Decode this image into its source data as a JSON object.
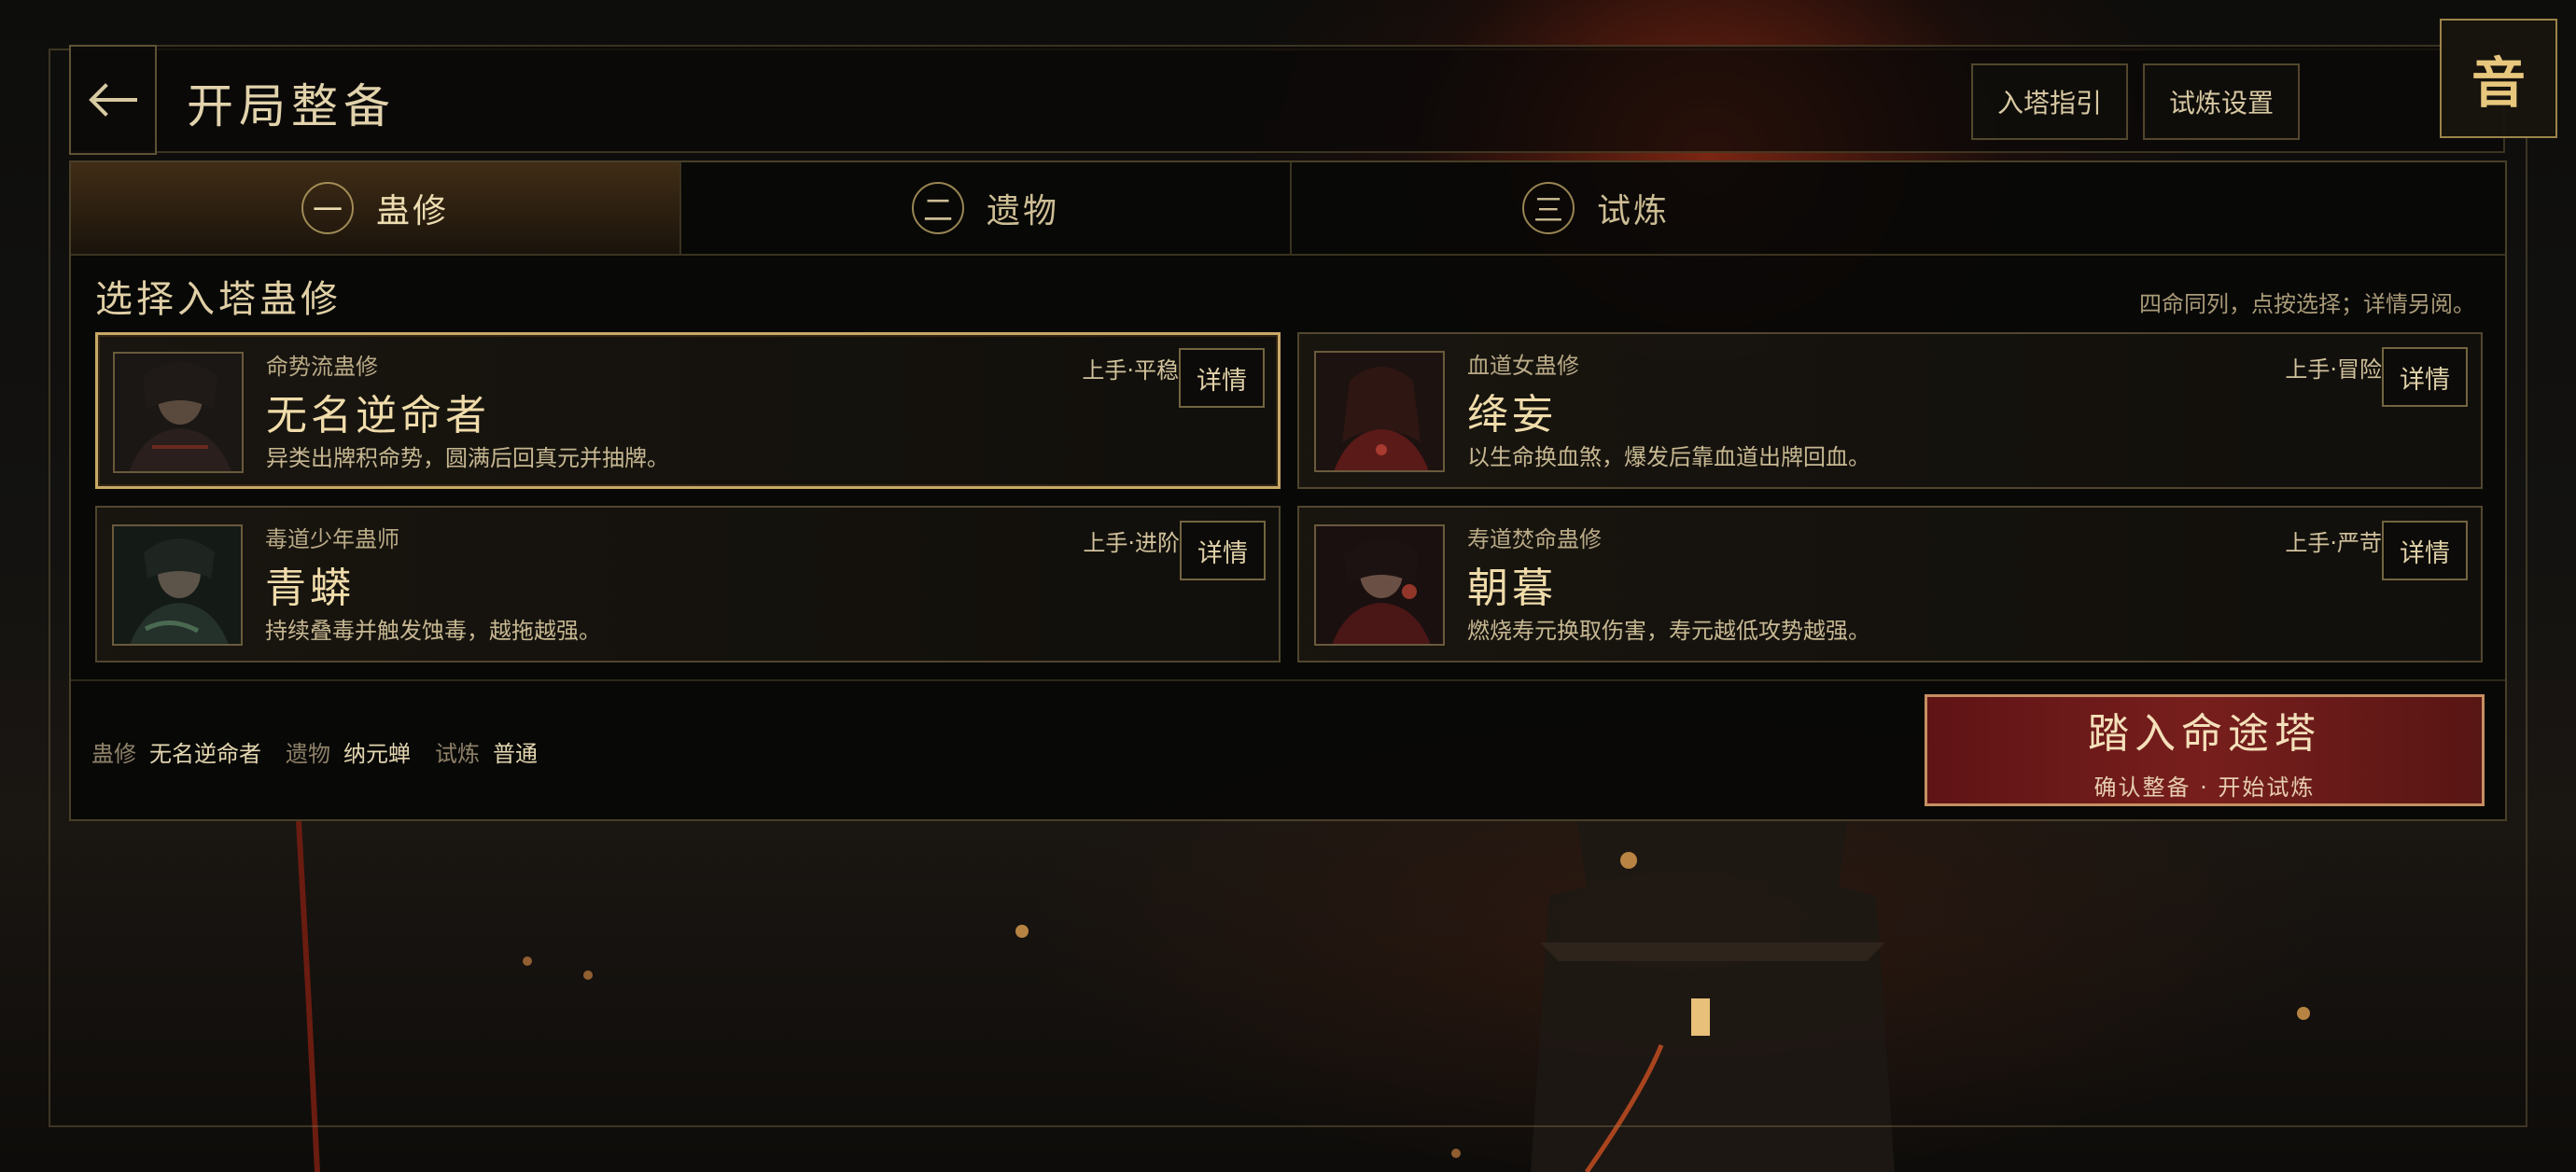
{
  "header": {
    "back_icon": "left-arrow-icon",
    "title": "开局整备",
    "buttons": [
      "入塔指引",
      "试炼设置"
    ],
    "sound_label": "音"
  },
  "tabs": [
    {
      "num": "一",
      "label": "蛊修",
      "active": true
    },
    {
      "num": "二",
      "label": "遗物",
      "active": false
    },
    {
      "num": "三",
      "label": "试炼",
      "active": false
    }
  ],
  "section": {
    "title": "选择入塔蛊修",
    "hint": "四命同列，点按选择；详情另阅。"
  },
  "cards": [
    {
      "subtitle": "命势流蛊修",
      "name": "无名逆命者",
      "desc": "异类出牌积命势，圆满后回真元并抽牌。",
      "difficulty": "上手·平稳",
      "detail": "详情",
      "selected": true
    },
    {
      "subtitle": "血道女蛊修",
      "name": "绛妄",
      "desc": "以生命换血煞，爆发后靠血道出牌回血。",
      "difficulty": "上手·冒险",
      "detail": "详情",
      "selected": false
    },
    {
      "subtitle": "毒道少年蛊师",
      "name": "青蟒",
      "desc": "持续叠毒并触发蚀毒，越拖越强。",
      "difficulty": "上手·进阶",
      "detail": "详情",
      "selected": false
    },
    {
      "subtitle": "寿道焚命蛊修",
      "name": "朝暮",
      "desc": "燃烧寿元换取伤害，寿元越低攻势越强。",
      "difficulty": "上手·严苛",
      "detail": "详情",
      "selected": false
    }
  ],
  "summary": {
    "gu_label": "蛊修",
    "gu_value": "无名逆命者",
    "relic_label": "遗物",
    "relic_value": "纳元蝉",
    "trial_label": "试炼",
    "trial_value": "普通"
  },
  "enter": {
    "main": "踏入命途塔",
    "sub": "确认整备 · 开始试炼"
  },
  "colors": {
    "gold": "#c9a866",
    "enter_bg": "#7d201e",
    "text": "#d8c9a3"
  }
}
